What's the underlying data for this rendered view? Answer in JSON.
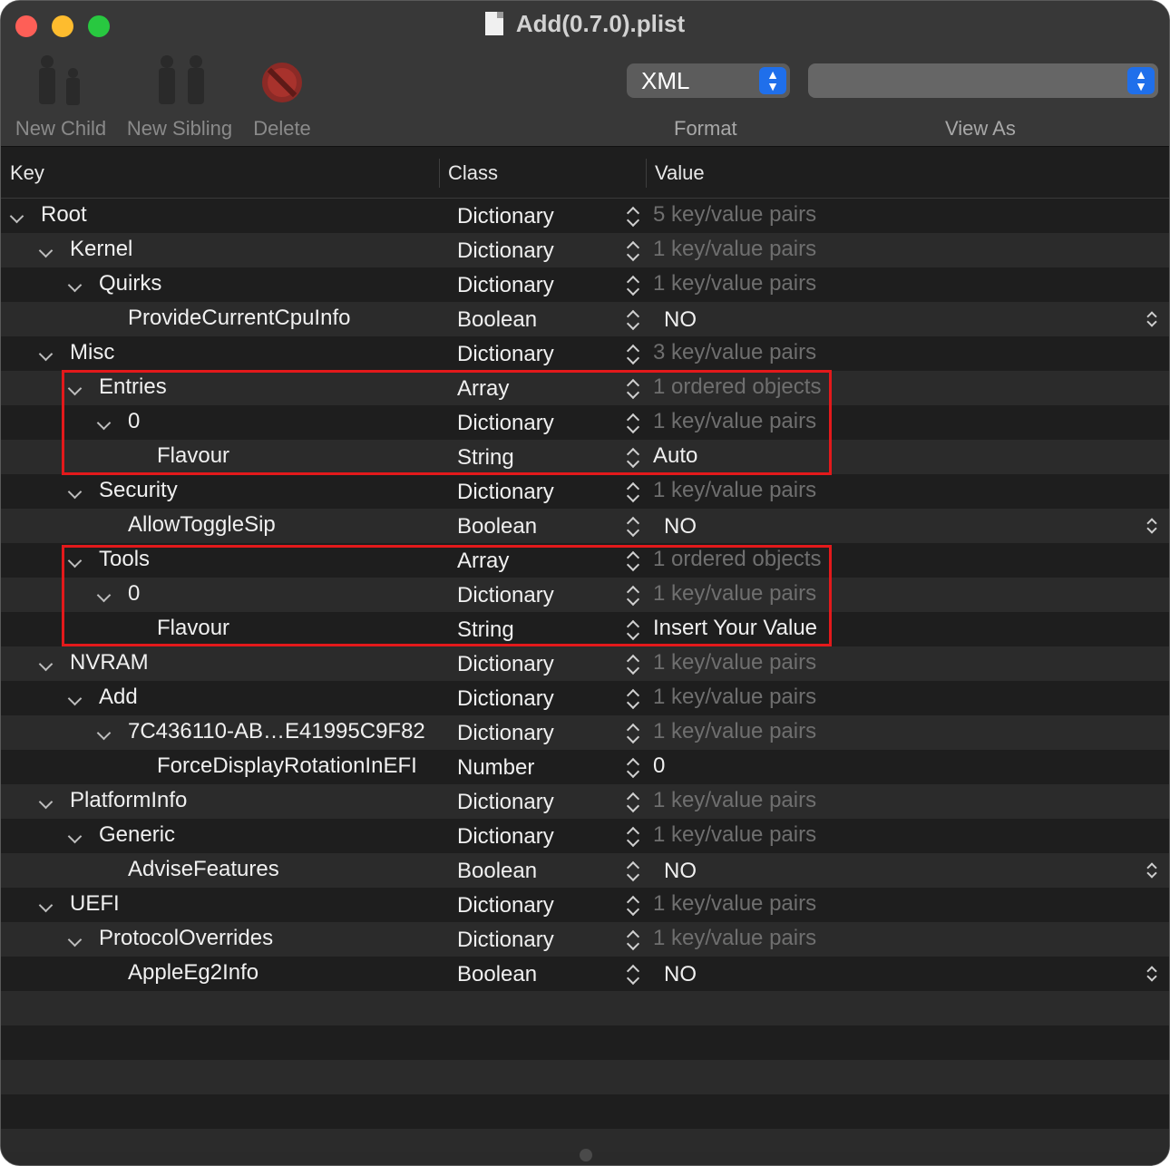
{
  "window": {
    "title": "Add(0.7.0).plist"
  },
  "toolbar": {
    "new_child": "New Child",
    "new_sibling": "New Sibling",
    "delete": "Delete",
    "format_value": "XML",
    "view_as_value": "",
    "format_caption": "Format",
    "view_as_caption": "View As"
  },
  "columns": {
    "key": "Key",
    "class": "Class",
    "value": "Value"
  },
  "rows": [
    {
      "key": "Root",
      "class": "Dictionary",
      "value": "5 key/value pairs",
      "level": 0,
      "expandable": true,
      "dim": true
    },
    {
      "key": "Kernel",
      "class": "Dictionary",
      "value": "1 key/value pairs",
      "level": 1,
      "expandable": true,
      "dim": true
    },
    {
      "key": "Quirks",
      "class": "Dictionary",
      "value": "1 key/value pairs",
      "level": 2,
      "expandable": true,
      "dim": true
    },
    {
      "key": "ProvideCurrentCpuInfo",
      "class": "Boolean",
      "value": "NO",
      "level": 3,
      "expandable": false,
      "bool": true
    },
    {
      "key": "Misc",
      "class": "Dictionary",
      "value": "3 key/value pairs",
      "level": 1,
      "expandable": true,
      "dim": true
    },
    {
      "key": "Entries",
      "class": "Array",
      "value": "1 ordered objects",
      "level": 2,
      "expandable": true,
      "dim": true
    },
    {
      "key": "0",
      "class": "Dictionary",
      "value": "1 key/value pairs",
      "level": 3,
      "expandable": true,
      "dim": true
    },
    {
      "key": "Flavour",
      "class": "String",
      "value": "Auto",
      "level": 4,
      "expandable": false
    },
    {
      "key": "Security",
      "class": "Dictionary",
      "value": "1 key/value pairs",
      "level": 2,
      "expandable": true,
      "dim": true
    },
    {
      "key": "AllowToggleSip",
      "class": "Boolean",
      "value": "NO",
      "level": 3,
      "expandable": false,
      "bool": true
    },
    {
      "key": "Tools",
      "class": "Array",
      "value": "1 ordered objects",
      "level": 2,
      "expandable": true,
      "dim": true
    },
    {
      "key": "0",
      "class": "Dictionary",
      "value": "1 key/value pairs",
      "level": 3,
      "expandable": true,
      "dim": true
    },
    {
      "key": "Flavour",
      "class": "String",
      "value": "Insert Your Value",
      "level": 4,
      "expandable": false
    },
    {
      "key": "NVRAM",
      "class": "Dictionary",
      "value": "1 key/value pairs",
      "level": 1,
      "expandable": true,
      "dim": true
    },
    {
      "key": "Add",
      "class": "Dictionary",
      "value": "1 key/value pairs",
      "level": 2,
      "expandable": true,
      "dim": true
    },
    {
      "key": "7C436110-AB…E41995C9F82",
      "class": "Dictionary",
      "value": "1 key/value pairs",
      "level": 3,
      "expandable": true,
      "dim": true
    },
    {
      "key": "ForceDisplayRotationInEFI",
      "class": "Number",
      "value": "0",
      "level": 4,
      "expandable": false
    },
    {
      "key": "PlatformInfo",
      "class": "Dictionary",
      "value": "1 key/value pairs",
      "level": 1,
      "expandable": true,
      "dim": true
    },
    {
      "key": "Generic",
      "class": "Dictionary",
      "value": "1 key/value pairs",
      "level": 2,
      "expandable": true,
      "dim": true
    },
    {
      "key": "AdviseFeatures",
      "class": "Boolean",
      "value": "NO",
      "level": 3,
      "expandable": false,
      "bool": true
    },
    {
      "key": "UEFI",
      "class": "Dictionary",
      "value": "1 key/value pairs",
      "level": 1,
      "expandable": true,
      "dim": true
    },
    {
      "key": "ProtocolOverrides",
      "class": "Dictionary",
      "value": "1 key/value pairs",
      "level": 2,
      "expandable": true,
      "dim": true
    },
    {
      "key": "AppleEg2Info",
      "class": "Boolean",
      "value": "NO",
      "level": 3,
      "expandable": false,
      "bool": true
    }
  ],
  "colors": {
    "highlight": "#e3191b",
    "accent": "#1f6feb"
  }
}
